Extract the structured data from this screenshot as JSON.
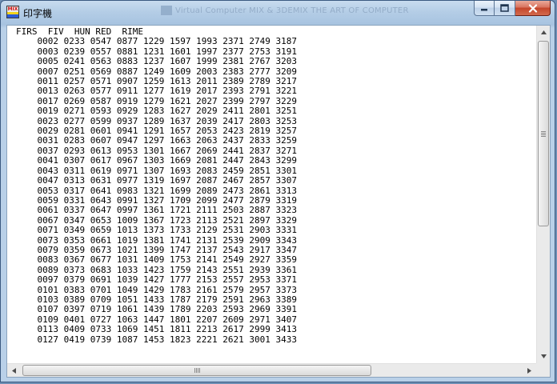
{
  "window": {
    "title": "印字機",
    "icon_label": "MIX",
    "background_window_text": "Virtual Computer MIX & 3DEMIX    THE ART OF COMPUTER"
  },
  "caption_buttons": {
    "minimize_icon": "minimize-icon",
    "maximize_icon": "maximize-icon",
    "close_icon": "close-icon"
  },
  "output": {
    "header": "FIRS  FIV  HUN RED  RIME",
    "rows": [
      "    0002 0233 0547 0877 1229 1597 1993 2371 2749 3187",
      "    0003 0239 0557 0881 1231 1601 1997 2377 2753 3191",
      "    0005 0241 0563 0883 1237 1607 1999 2381 2767 3203",
      "    0007 0251 0569 0887 1249 1609 2003 2383 2777 3209",
      "    0011 0257 0571 0907 1259 1613 2011 2389 2789 3217",
      "    0013 0263 0577 0911 1277 1619 2017 2393 2791 3221",
      "    0017 0269 0587 0919 1279 1621 2027 2399 2797 3229",
      "    0019 0271 0593 0929 1283 1627 2029 2411 2801 3251",
      "    0023 0277 0599 0937 1289 1637 2039 2417 2803 3253",
      "    0029 0281 0601 0941 1291 1657 2053 2423 2819 3257",
      "    0031 0283 0607 0947 1297 1663 2063 2437 2833 3259",
      "    0037 0293 0613 0953 1301 1667 2069 2441 2837 3271",
      "    0041 0307 0617 0967 1303 1669 2081 2447 2843 3299",
      "    0043 0311 0619 0971 1307 1693 2083 2459 2851 3301",
      "    0047 0313 0631 0977 1319 1697 2087 2467 2857 3307",
      "    0053 0317 0641 0983 1321 1699 2089 2473 2861 3313",
      "    0059 0331 0643 0991 1327 1709 2099 2477 2879 3319",
      "    0061 0337 0647 0997 1361 1721 2111 2503 2887 3323",
      "    0067 0347 0653 1009 1367 1723 2113 2521 2897 3329",
      "    0071 0349 0659 1013 1373 1733 2129 2531 2903 3331",
      "    0073 0353 0661 1019 1381 1741 2131 2539 2909 3343",
      "    0079 0359 0673 1021 1399 1747 2137 2543 2917 3347",
      "    0083 0367 0677 1031 1409 1753 2141 2549 2927 3359",
      "    0089 0373 0683 1033 1423 1759 2143 2551 2939 3361",
      "    0097 0379 0691 1039 1427 1777 2153 2557 2953 3371",
      "    0101 0383 0701 1049 1429 1783 2161 2579 2957 3373",
      "    0103 0389 0709 1051 1433 1787 2179 2591 2963 3389",
      "    0107 0397 0719 1061 1439 1789 2203 2593 2969 3391",
      "    0109 0401 0727 1063 1447 1801 2207 2609 2971 3407",
      "    0113 0409 0733 1069 1451 1811 2213 2617 2999 3413",
      "    0127 0419 0739 1087 1453 1823 2221 2621 3001 3433"
    ]
  },
  "scrollbars": {
    "vertical": {
      "up_icon": "scroll-up-arrow-icon",
      "down_icon": "scroll-down-arrow-icon",
      "position": 0.0
    },
    "horizontal": {
      "left_icon": "scroll-left-arrow-icon",
      "right_icon": "scroll-right-arrow-icon",
      "position": 0.0
    }
  }
}
